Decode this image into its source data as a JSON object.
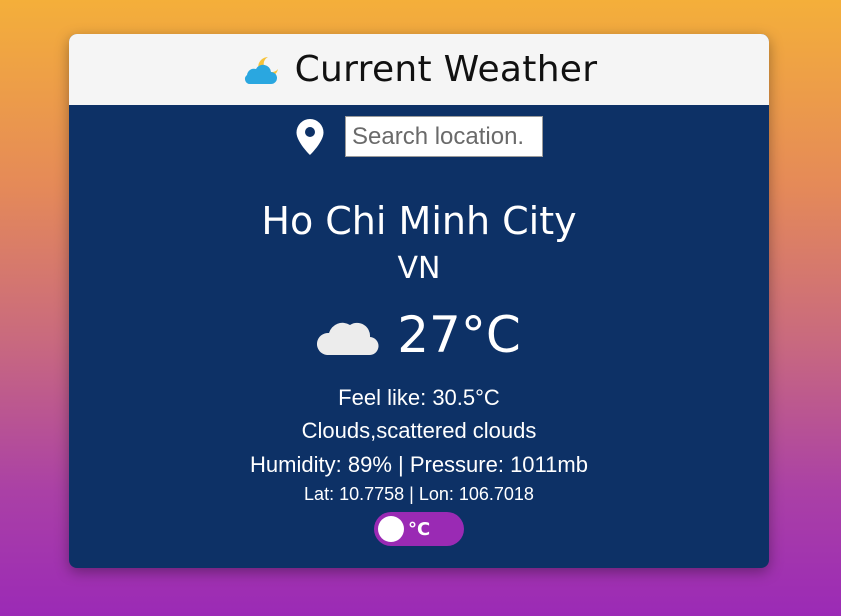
{
  "header": {
    "title": "Current Weather",
    "icon": "partly-cloudy-night-icon"
  },
  "search": {
    "placeholder": "Search location.",
    "value": "",
    "icon": "location-pin-icon"
  },
  "location": {
    "city": "Ho Chi Minh City",
    "country": "VN"
  },
  "weather": {
    "icon": "cloud-icon",
    "temperature": "27°C",
    "feels_like": "Feel like: 30.5°C",
    "description": "Clouds,scattered clouds",
    "humidity_pressure": "Humidity: 89% | Pressure: 1011mb",
    "coordinates": "Lat: 10.7758 | Lon: 106.7018"
  },
  "unit_toggle": {
    "label": "°C",
    "state": "celsius"
  },
  "colors": {
    "card_body": "#0d3166",
    "header_bg": "#f5f5f5",
    "toggle_bg": "#9a2ab4",
    "sun_yellow": "#f6c33a",
    "cloud_blue": "#2aa7e0"
  }
}
